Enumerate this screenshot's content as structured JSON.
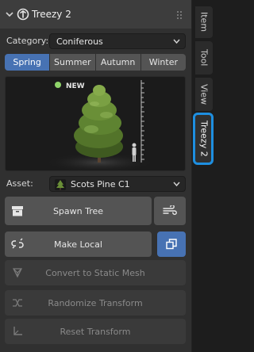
{
  "panel": {
    "title": "Treezy 2"
  },
  "category": {
    "label": "Category:",
    "value": "Coniferous"
  },
  "season_tabs": [
    {
      "label": "Spring",
      "active": true
    },
    {
      "label": "Summer",
      "active": false
    },
    {
      "label": "Autumn",
      "active": false
    },
    {
      "label": "Winter",
      "active": false
    }
  ],
  "preview": {
    "badge": "NEW"
  },
  "asset": {
    "label": "Asset:",
    "value": "Scots Pine C1"
  },
  "buttons": {
    "spawn_tree": "Spawn Tree",
    "make_local": "Make Local",
    "convert": "Convert to Static Mesh",
    "randomize": "Randomize Transform",
    "reset": "Reset Transform"
  },
  "side_tabs": [
    {
      "label": "Item",
      "active": false
    },
    {
      "label": "Tool",
      "active": false
    },
    {
      "label": "View",
      "active": false
    },
    {
      "label": "Treezy 2",
      "active": true
    }
  ],
  "colors": {
    "accent": "#4772b3",
    "tab_highlight": "#1e8fe0",
    "new_dot": "#8fd46a"
  }
}
